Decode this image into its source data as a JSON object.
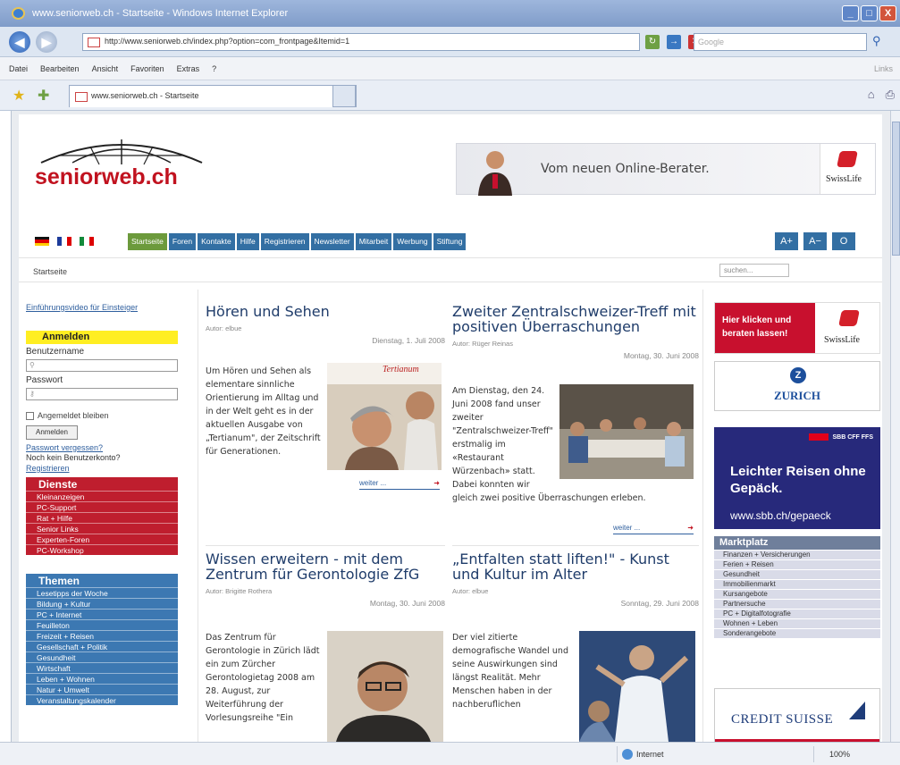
{
  "window": {
    "title": "www.seniorweb.ch - Startseite - Windows Internet Explorer",
    "controls": [
      "_",
      "□",
      "X"
    ]
  },
  "addressbar": {
    "url": "http://www.seniorweb.ch/index.php?option=com_frontpage&Itemid=1",
    "search_placeholder": "Google"
  },
  "menu": {
    "items": [
      "Datei",
      "Bearbeiten",
      "Ansicht",
      "Favoriten",
      "Extras",
      "?"
    ],
    "links": "Links"
  },
  "tab": {
    "title": "www.seniorweb.ch - Startseite"
  },
  "site": {
    "logo": "seniorweb.ch",
    "banner": {
      "text": "Vom neuen Online-Berater.",
      "brand": "SwissLife"
    },
    "nav": [
      "Startseite",
      "Foren",
      "Kontakte",
      "Hilfe",
      "Registrieren",
      "Newsletter",
      "Mitarbeit",
      "Werbung",
      "Stiftung"
    ],
    "font_controls": [
      "A+",
      "A−",
      "O"
    ],
    "breadcrumb": "Startseite",
    "search_placeholder": "suchen..."
  },
  "login": {
    "intro": "Einführungsvideo für Einsteiger",
    "heading": "Anmelden",
    "username_label": "Benutzername",
    "password_label": "Passwort",
    "remember": "Angemeldet bleiben",
    "button": "Anmelden",
    "forgot": "Passwort vergessen?",
    "no_account": "Noch kein Benutzerkonto?",
    "register": "Registrieren"
  },
  "dienste": {
    "title": "Dienste",
    "items": [
      "Kleinanzeigen",
      "PC-Support",
      "Rat + Hilfe",
      "Senior Links",
      "Experten-Foren",
      "PC-Workshop"
    ]
  },
  "themen": {
    "title": "Themen",
    "items": [
      "Lesetipps der Woche",
      "Bildung + Kultur",
      "PC + Internet",
      "Feuilleton",
      "Freizeit + Reisen",
      "Gesellschaft + Politik",
      "Gesundheit",
      "Wirtschaft",
      "Leben + Wohnen",
      "Natur + Umwelt",
      "Veranstaltungskalender"
    ]
  },
  "articles": [
    {
      "title": "Hören und Sehen",
      "author": "Autor: elbue",
      "date": "Dienstag, 1. Juli 2008",
      "text": "Um Hören und Sehen als elementare sinnliche Orientierung im Alltag und in der Welt geht es in der aktuellen Ausgabe von „Tertianum\", der Zeitschrift für Generationen.",
      "more": "weiter ...",
      "img_label": "Tertianum"
    },
    {
      "title": "Zweiter Zentralschweizer-Treff mit positiven Überraschungen",
      "author": "Autor: Rüger Reinas",
      "date": "Montag, 30. Juni 2008",
      "text": "Am Dienstag, den 24. Juni 2008 fand unser zweiter \"Zentralschweizer-Treff\" erstmalig im «Restaurant Würzenbach» statt. Dabei konnten wir gleich zwei positive Überraschungen erleben.",
      "more": "weiter ..."
    },
    {
      "title": "Wissen erweitern - mit dem Zentrum für Gerontologie ZfG",
      "author": "Autor: Brigitte Rothera",
      "date": "Montag, 30. Juni 2008",
      "text": "Das Zentrum für Gerontologie in Zürich lädt ein zum Zürcher Gerontologietag 2008 am 28. August, zur Weiterführung der Vorlesungsreihe \"Ein"
    },
    {
      "title": "„Entfalten statt liften!\" - Kunst und Kultur im Alter",
      "author": "Autor: elbue",
      "date": "Sonntag, 29. Juni 2008",
      "text": "Der viel zitierte demografische Wandel und seine Auswirkungen sind längst Realität. Mehr Menschen haben in der nachberuflichen"
    }
  ],
  "ads": {
    "swisslife": {
      "text": "Hier klicken und beraten lassen!",
      "brand": "SwissLife"
    },
    "zurich": {
      "brand": "ZURICH"
    },
    "sbb": {
      "tag": "SBB CFF FFS",
      "headline": "Leichter Reisen ohne Gepäck.",
      "url": "www.sbb.ch/gepaeck"
    },
    "cs": {
      "brand": "CREDIT SUISSE"
    }
  },
  "marktplatz": {
    "title": "Marktplatz",
    "items": [
      "Finanzen + Versicherungen",
      "Ferien + Reisen",
      "Gesundheit",
      "Immobilienmarkt",
      "Kursangebote",
      "Partnersuche",
      "PC + Digitalfotografie",
      "Wohnen + Leben",
      "Sonderangebote"
    ]
  },
  "status": {
    "zone": "Internet",
    "zoom": "100%"
  }
}
